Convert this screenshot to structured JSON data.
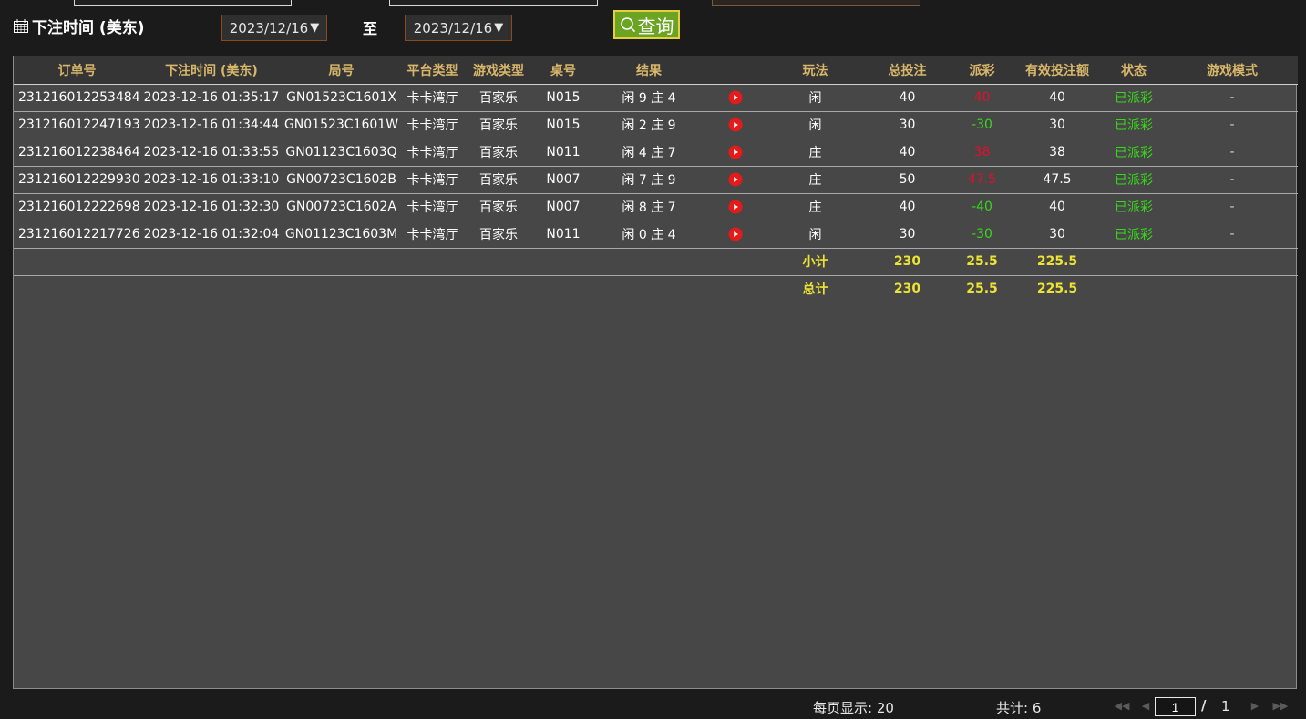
{
  "filters": {
    "time_label": "下注时间 (美东)",
    "start_date": "2023/12/16",
    "end_date": "2023/12/16",
    "arrow": "▼",
    "to_label": "至",
    "query_label": "查询"
  },
  "table": {
    "headers": [
      "订单号",
      "下注时间 (美东)",
      "局号",
      "平台类型",
      "游戏类型",
      "桌号",
      "结果",
      "",
      "玩法",
      "总投注",
      "派彩",
      "有效投注额",
      "状态",
      "游戏模式"
    ],
    "rows": [
      {
        "order": "231216012253484",
        "time": "2023-12-16 01:35:17",
        "round": "GN01523C1601X",
        "platform": "卡卡湾厅",
        "game": "百家乐",
        "table": "N015",
        "result": "闲 9 庄 4",
        "play": "闲",
        "bet": "40",
        "payout": "40",
        "valid": "40",
        "status": "已派彩",
        "mode": "-"
      },
      {
        "order": "231216012247193",
        "time": "2023-12-16 01:34:44",
        "round": "GN01523C1601W",
        "platform": "卡卡湾厅",
        "game": "百家乐",
        "table": "N015",
        "result": "闲 2 庄 9",
        "play": "闲",
        "bet": "30",
        "payout": "-30",
        "valid": "30",
        "status": "已派彩",
        "mode": "-"
      },
      {
        "order": "231216012238464",
        "time": "2023-12-16 01:33:55",
        "round": "GN01123C1603Q",
        "platform": "卡卡湾厅",
        "game": "百家乐",
        "table": "N011",
        "result": "闲 4 庄 7",
        "play": "庄",
        "bet": "40",
        "payout": "38",
        "valid": "38",
        "status": "已派彩",
        "mode": "-"
      },
      {
        "order": "231216012229930",
        "time": "2023-12-16 01:33:10",
        "round": "GN00723C1602B",
        "platform": "卡卡湾厅",
        "game": "百家乐",
        "table": "N007",
        "result": "闲 7 庄 9",
        "play": "庄",
        "bet": "50",
        "payout": "47.5",
        "valid": "47.5",
        "status": "已派彩",
        "mode": "-"
      },
      {
        "order": "231216012222698",
        "time": "2023-12-16 01:32:30",
        "round": "GN00723C1602A",
        "platform": "卡卡湾厅",
        "game": "百家乐",
        "table": "N007",
        "result": "闲 8 庄 7",
        "play": "庄",
        "bet": "40",
        "payout": "-40",
        "valid": "40",
        "status": "已派彩",
        "mode": "-"
      },
      {
        "order": "231216012217726",
        "time": "2023-12-16 01:32:04",
        "round": "GN01123C1603M",
        "platform": "卡卡湾厅",
        "game": "百家乐",
        "table": "N011",
        "result": "闲 0 庄 4",
        "play": "闲",
        "bet": "30",
        "payout": "-30",
        "valid": "30",
        "status": "已派彩",
        "mode": "-"
      }
    ],
    "subtotal": {
      "label": "小计",
      "bet": "230",
      "payout": "25.5",
      "valid": "225.5"
    },
    "total": {
      "label": "总计",
      "bet": "230",
      "payout": "25.5",
      "valid": "225.5"
    }
  },
  "footer": {
    "per_page": "每页显示: 20",
    "total_count": "共计: 6",
    "current_page": "1",
    "slash": "/",
    "total_pages": "1",
    "first_icon": "◀◀",
    "prev_icon": "◀",
    "next_icon": "▶",
    "last_icon": "▶▶"
  },
  "colors": {
    "win": "#e0102a",
    "loss": "#38d81c",
    "header": "#d9b76a",
    "summary": "#ede333"
  }
}
